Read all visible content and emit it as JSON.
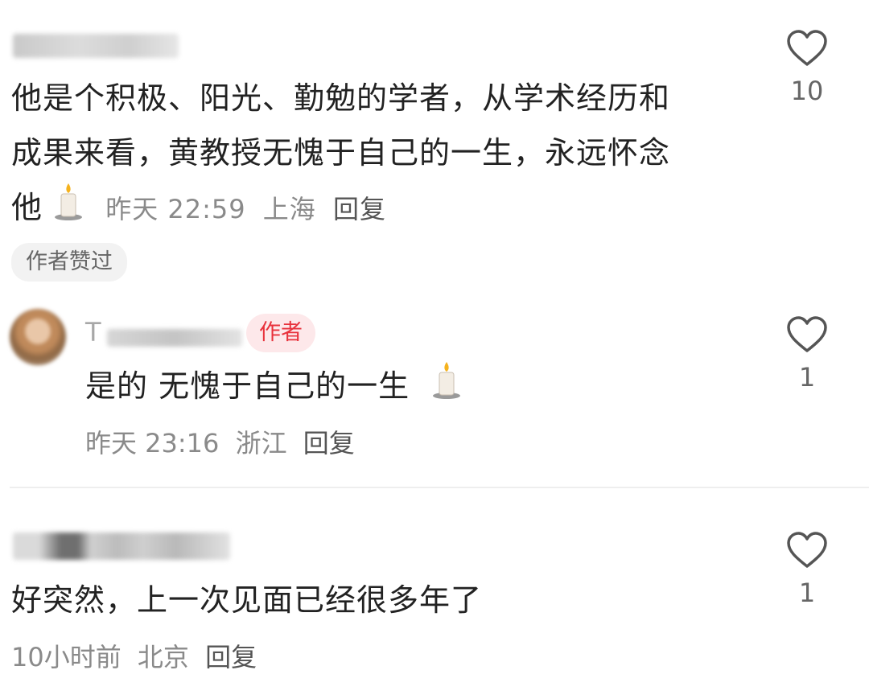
{
  "comments": [
    {
      "text_lines": [
        "他是个积极、阳光、勤勉的学者，从学术经历和",
        "成果来看，黄教授无愧于自己的一生，永远怀念",
        "他"
      ],
      "time": "昨天 22:59",
      "location": "上海",
      "reply_label": "回复",
      "likes": "10",
      "badge": "作者赞过"
    },
    {
      "author_initial": "T",
      "author_badge": "作者",
      "text": "是的 无愧于自己的一生",
      "time": "昨天 23:16",
      "location": "浙江",
      "reply_label": "回复",
      "likes": "1"
    },
    {
      "text": "好突然，上一次见面已经很多年了",
      "time": "10小时前",
      "location": "北京",
      "reply_label": "回复",
      "likes": "1"
    }
  ],
  "icons": {
    "like": "heart-outline-icon",
    "emoji": "candle-emoji-icon"
  }
}
